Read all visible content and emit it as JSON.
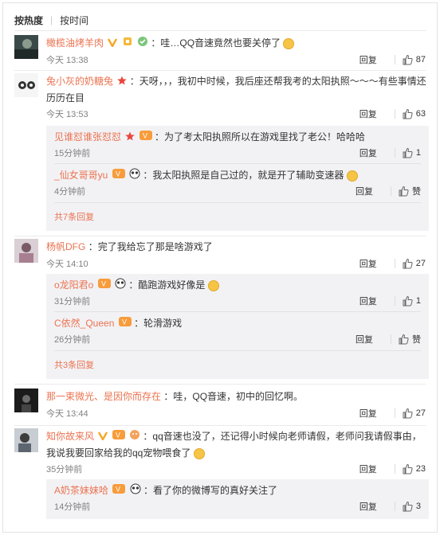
{
  "sort": {
    "hot": "按热度",
    "time": "按时间"
  },
  "colors": {
    "username": "#eb7350",
    "text": "#333333",
    "meta": "#808080",
    "subbg": "#f2f2f5"
  },
  "actions": {
    "reply": "回复",
    "like_placeholder": "赞"
  },
  "comments": [
    {
      "user": "橄榄油烤羊肉",
      "text": "：哇…QQ音速竟然也要关停了",
      "time": "今天 13:38",
      "likes": "87",
      "badges": [
        "v-badge",
        "cup-badge",
        "leaf-badge"
      ],
      "replies": []
    },
    {
      "user": "兔小灰的奶糖兔",
      "text": "：天呀，，，我初中时候，我后座还帮我考的太阳执照～～～有些事情还历历在目",
      "time": "今天 13:53",
      "likes": "63",
      "badges": [
        "star-badge"
      ],
      "replies": [
        {
          "user": "见谁怼谁张怼怼",
          "text": "：为了考太阳执照所以在游戏里找了老公！哈哈哈",
          "time": "15分钟前",
          "likes": "1"
        },
        {
          "user": "_仙女哥哥yu",
          "text": "：我太阳执照是自己过的，就是开了辅助变速器",
          "time": "4分钟前",
          "likes": "赞"
        }
      ],
      "more": "共7条回复"
    },
    {
      "user": "杨帆DFG",
      "text": "：完了我给忘了那是啥游戏了",
      "time": "今天 14:10",
      "likes": "27",
      "badges": [],
      "replies": [
        {
          "user": "o龙阳君o",
          "text": "：酷跑游戏好像是",
          "time": "31分钟前",
          "likes": "1"
        },
        {
          "user": "C依然_Queen",
          "text": "：轮滑游戏",
          "time": "26分钟前",
          "likes": "赞"
        }
      ],
      "more": "共3条回复"
    },
    {
      "user": "那一束微光、是因你而存在",
      "text": "：哇，QQ音速，初中的回忆啊。",
      "time": "今天 13:44",
      "likes": "27",
      "badges": [],
      "replies": []
    },
    {
      "user": "知你故来风",
      "text": "：qq音速也没了，还记得小时候向老师请假，老师问我请假事由，我说我要回家给我的qq宠物喂食了",
      "time": "35分钟前",
      "likes": "23",
      "badges": [
        "v-badge",
        "cup-badge",
        "face-badge"
      ],
      "replies": [
        {
          "user": "A奶茶妹妹哈",
          "text": "：看了你的微博写的真好关注了",
          "time": "14分钟前",
          "likes": "3"
        }
      ]
    }
  ]
}
